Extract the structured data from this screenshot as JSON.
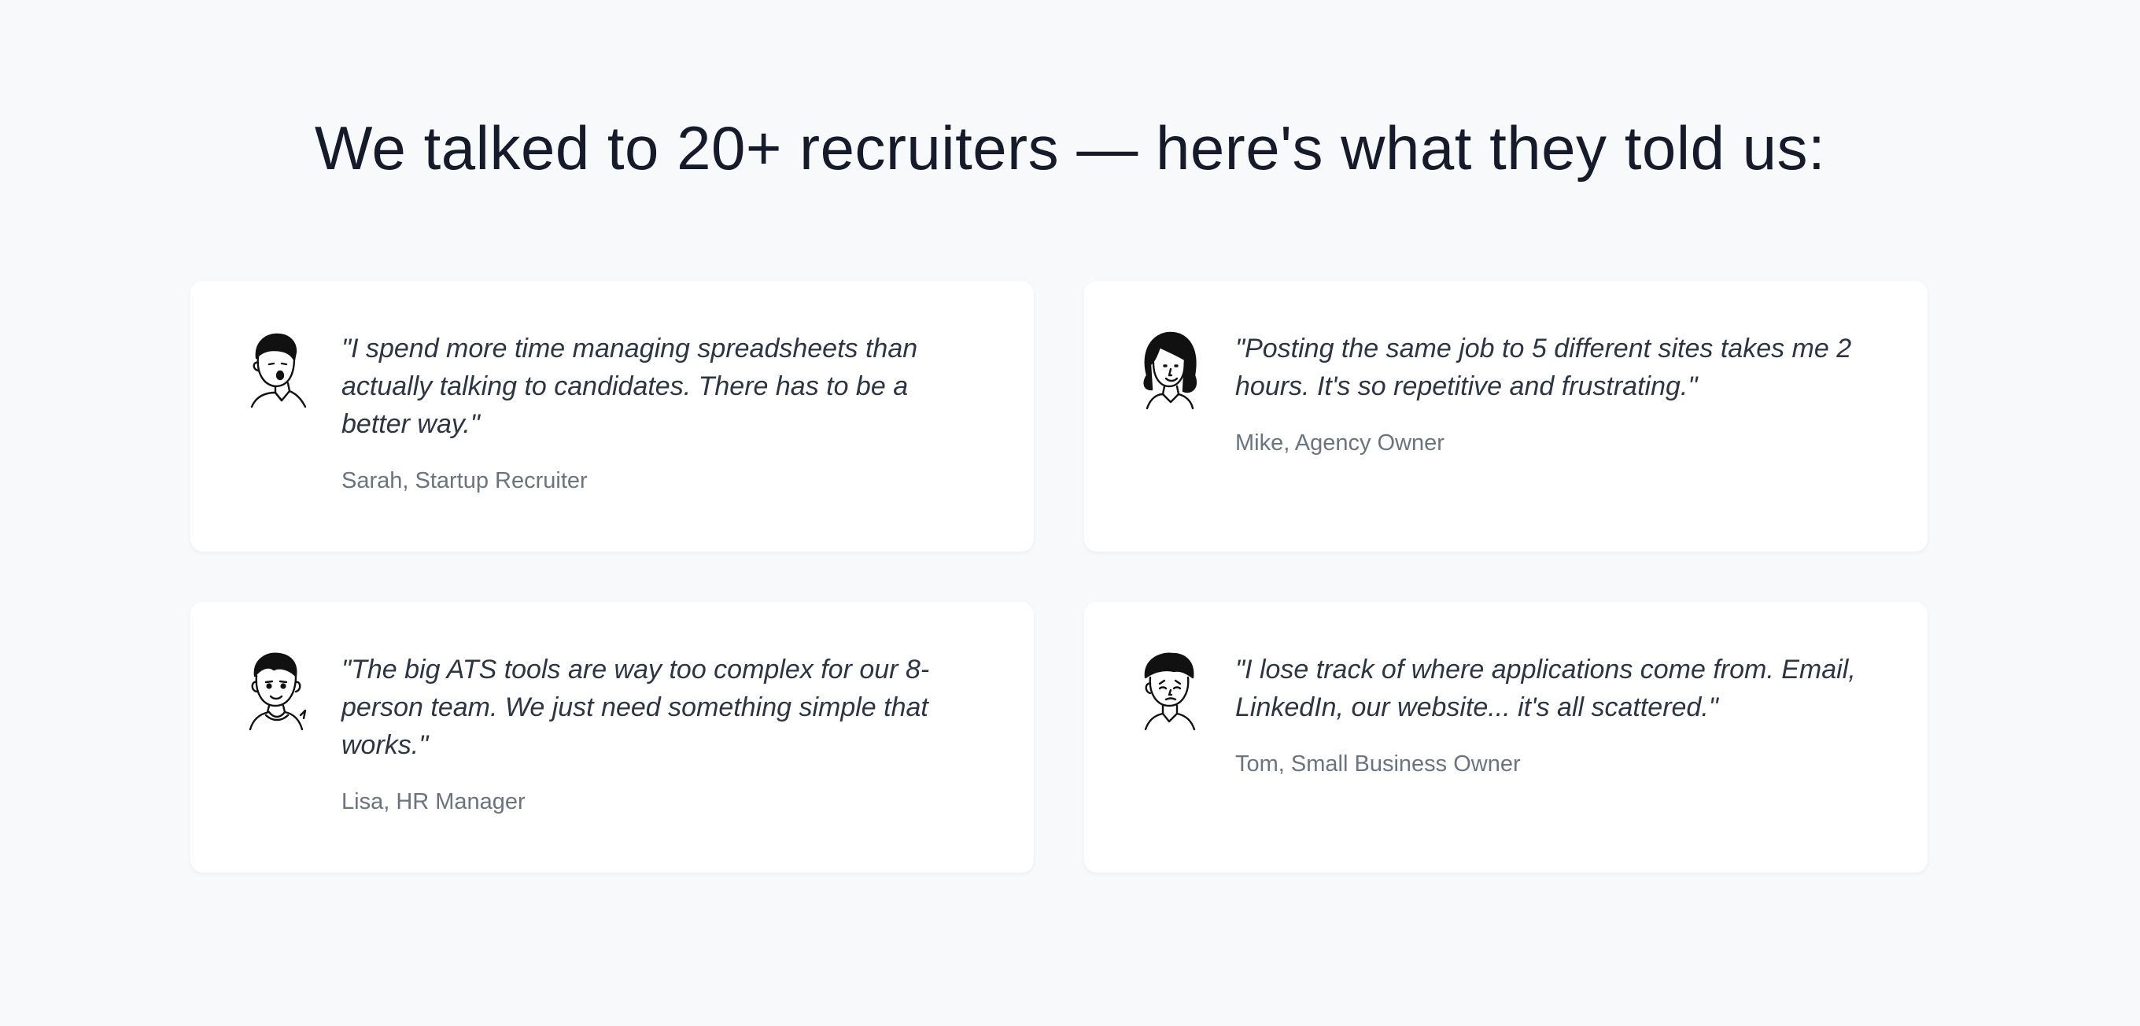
{
  "heading": "We talked to 20+ recruiters — here's what they told us:",
  "testimonials": [
    {
      "quote": "\"I spend more time managing spreadsheets than actually talking to candidates. There has to be a better way.\"",
      "author": "Sarah, Startup Recruiter",
      "avatar_icon": "man-surprised-avatar-icon"
    },
    {
      "quote": "\"Posting the same job to 5 different sites takes me 2 hours. It's so repetitive and frustrating.\"",
      "author": "Mike, Agency Owner",
      "avatar_icon": "woman-smiling-avatar-icon"
    },
    {
      "quote": "\"The big ATS tools are way too complex for our 8-person team. We just need something simple that works.\"",
      "author": "Lisa, HR Manager",
      "avatar_icon": "man-smiling-avatar-icon"
    },
    {
      "quote": "\"I lose track of where applications come from. Email, LinkedIn, our website... it's all scattered.\"",
      "author": "Tom, Small Business Owner",
      "avatar_icon": "man-worried-avatar-icon"
    }
  ],
  "colors": {
    "background": "#f8f9fb",
    "card": "#ffffff",
    "heading": "#161b2b",
    "quote": "#2d3545",
    "author": "#6b7280"
  }
}
